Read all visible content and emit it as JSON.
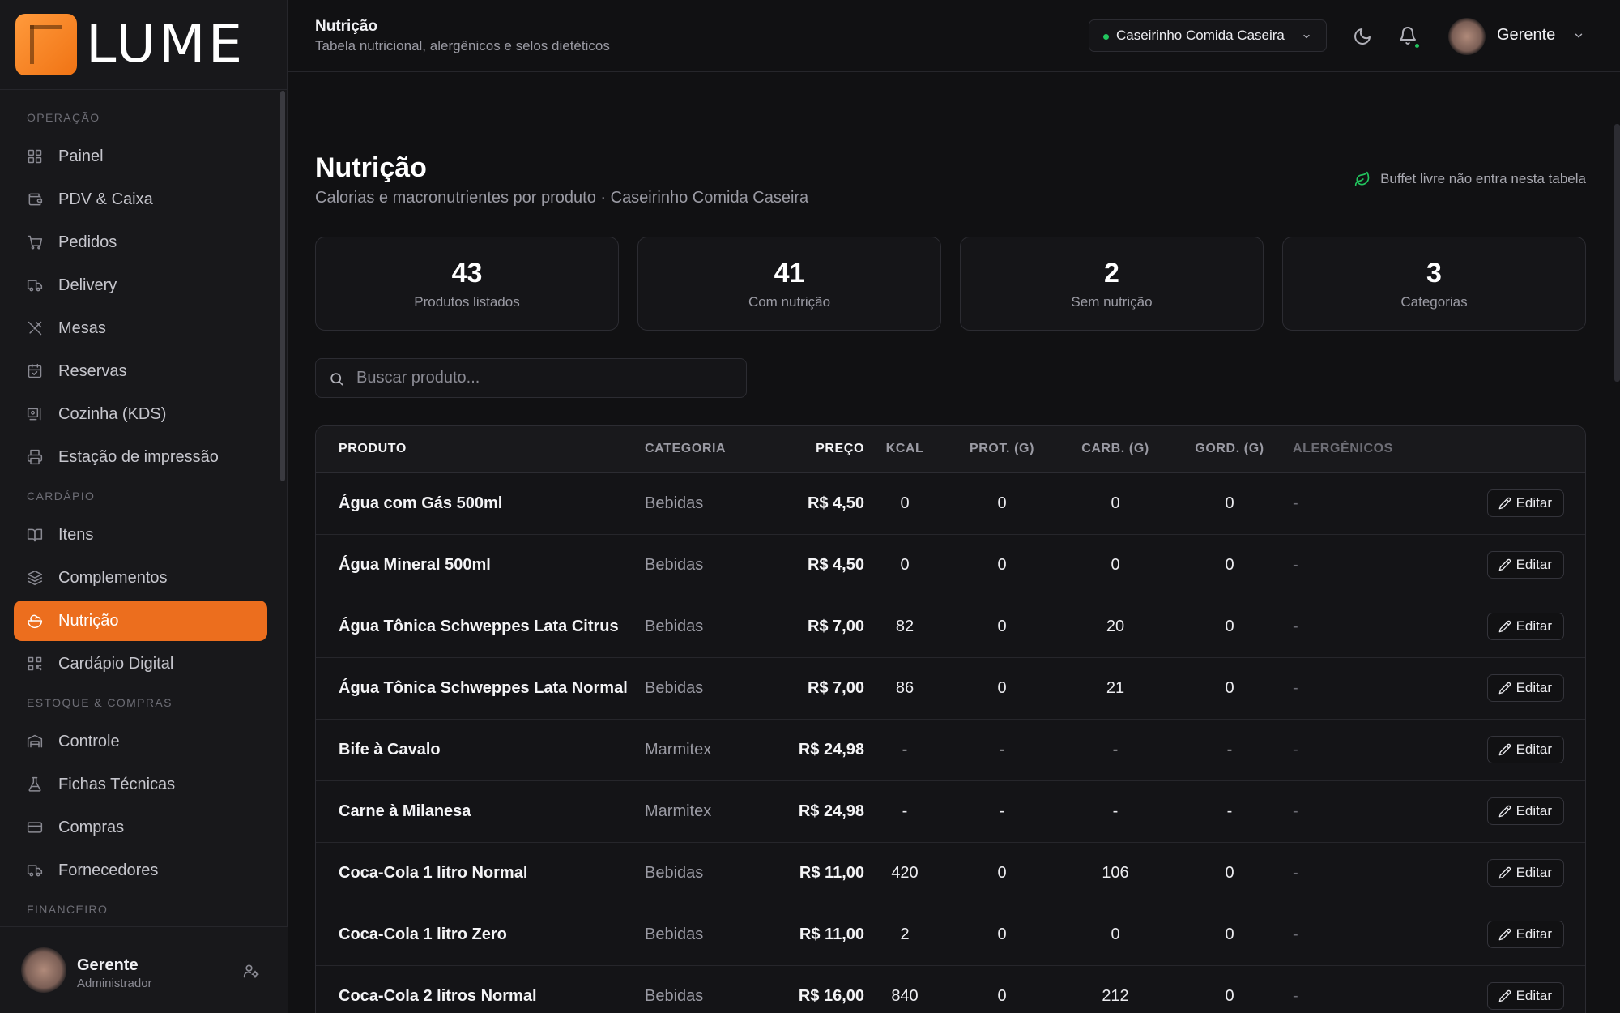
{
  "brand": {
    "name": "LUME"
  },
  "sidebar": {
    "sections": [
      {
        "label": "OPERAÇÃO",
        "items": [
          {
            "label": "Painel",
            "icon": "grid-icon"
          },
          {
            "label": "PDV & Caixa",
            "icon": "wallet-icon"
          },
          {
            "label": "Pedidos",
            "icon": "cart-icon"
          },
          {
            "label": "Delivery",
            "icon": "truck-icon"
          },
          {
            "label": "Mesas",
            "icon": "utensils-icon"
          },
          {
            "label": "Reservas",
            "icon": "calendar-check-icon"
          },
          {
            "label": "Cozinha (KDS)",
            "icon": "monitor-icon"
          },
          {
            "label": "Estação de impressão",
            "icon": "printer-icon"
          }
        ]
      },
      {
        "label": "CARDÁPIO",
        "items": [
          {
            "label": "Itens",
            "icon": "book-open-icon"
          },
          {
            "label": "Complementos",
            "icon": "layers-icon"
          },
          {
            "label": "Nutrição",
            "icon": "salad-icon",
            "active": true
          },
          {
            "label": "Cardápio Digital",
            "icon": "qr-code-icon"
          }
        ]
      },
      {
        "label": "ESTOQUE & COMPRAS",
        "items": [
          {
            "label": "Controle",
            "icon": "warehouse-icon"
          },
          {
            "label": "Fichas Técnicas",
            "icon": "flask-icon"
          },
          {
            "label": "Compras",
            "icon": "credit-card-icon"
          },
          {
            "label": "Fornecedores",
            "icon": "truck-icon"
          }
        ]
      },
      {
        "label": "FINANCEIRO",
        "items": []
      }
    ],
    "user": {
      "name": "Gerente",
      "role": "Administrador"
    }
  },
  "header": {
    "title": "Nutrição",
    "subtitle": "Tabela nutricional, alergênicos e selos dietéticos",
    "store": "Caseirinho Comida Caseira",
    "user": "Gerente"
  },
  "main": {
    "title": "Nutrição",
    "subtitle": "Calorias e macronutrientes por produto · Caseirinho Comida Caseira",
    "note": "Buffet livre não entra nesta tabela",
    "stats": [
      {
        "value": "43",
        "label": "Produtos listados"
      },
      {
        "value": "41",
        "label": "Com nutrição"
      },
      {
        "value": "2",
        "label": "Sem nutrição"
      },
      {
        "value": "3",
        "label": "Categorias"
      }
    ],
    "search": {
      "placeholder": "Buscar produto...",
      "value": ""
    },
    "table": {
      "columns": [
        "PRODUTO",
        "CATEGORIA",
        "PREÇO",
        "KCAL",
        "PROT. (G)",
        "CARB. (G)",
        "GORD. (G)",
        "ALERGÊNICOS"
      ],
      "edit_label": "Editar",
      "rows": [
        {
          "produto": "Água com Gás 500ml",
          "categoria": "Bebidas",
          "preco": "R$ 4,50",
          "kcal": "0",
          "prot": "0",
          "carb": "0",
          "gord": "0",
          "alergenicos": "-"
        },
        {
          "produto": "Água Mineral 500ml",
          "categoria": "Bebidas",
          "preco": "R$ 4,50",
          "kcal": "0",
          "prot": "0",
          "carb": "0",
          "gord": "0",
          "alergenicos": "-"
        },
        {
          "produto": "Água Tônica Schweppes Lata Citrus",
          "categoria": "Bebidas",
          "preco": "R$ 7,00",
          "kcal": "82",
          "prot": "0",
          "carb": "20",
          "gord": "0",
          "alergenicos": "-"
        },
        {
          "produto": "Água Tônica Schweppes Lata Normal",
          "categoria": "Bebidas",
          "preco": "R$ 7,00",
          "kcal": "86",
          "prot": "0",
          "carb": "21",
          "gord": "0",
          "alergenicos": "-"
        },
        {
          "produto": "Bife à Cavalo",
          "categoria": "Marmitex",
          "preco": "R$ 24,98",
          "kcal": "-",
          "prot": "-",
          "carb": "-",
          "gord": "-",
          "alergenicos": "-"
        },
        {
          "produto": "Carne à Milanesa",
          "categoria": "Marmitex",
          "preco": "R$ 24,98",
          "kcal": "-",
          "prot": "-",
          "carb": "-",
          "gord": "-",
          "alergenicos": "-"
        },
        {
          "produto": "Coca-Cola 1 litro Normal",
          "categoria": "Bebidas",
          "preco": "R$ 11,00",
          "kcal": "420",
          "prot": "0",
          "carb": "106",
          "gord": "0",
          "alergenicos": "-"
        },
        {
          "produto": "Coca-Cola 1 litro Zero",
          "categoria": "Bebidas",
          "preco": "R$ 11,00",
          "kcal": "2",
          "prot": "0",
          "carb": "0",
          "gord": "0",
          "alergenicos": "-"
        },
        {
          "produto": "Coca-Cola 2 litros Normal",
          "categoria": "Bebidas",
          "preco": "R$ 16,00",
          "kcal": "840",
          "prot": "0",
          "carb": "212",
          "gord": "0",
          "alergenicos": "-"
        }
      ]
    }
  },
  "colors": {
    "accent": "#ec6e1e",
    "success": "#22c55e",
    "background": "#111113",
    "surface": "#18181b"
  }
}
